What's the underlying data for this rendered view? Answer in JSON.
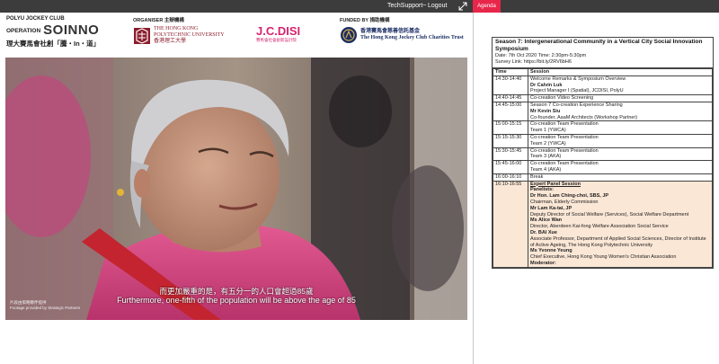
{
  "topbar": {
    "tech_support": "TechSupport~",
    "logout": "Logout",
    "agenda_tab": "Agenda"
  },
  "logos": {
    "polyu_club": "POLYU JOCKEY CLUB",
    "operation": "OPERATION",
    "soinno": "SOINNO",
    "zh_title": "理大賽馬會社創「騰・In・道」",
    "organiser_label": "ORGANISER 主辦機構",
    "polyu_line1": "THE HONG KONG",
    "polyu_line2": "POLYTECHNIC UNIVERSITY",
    "polyu_zh": "香港理工大學",
    "jcdisi": "J.C.DISI",
    "jcdisi_sub": "賽馬會社會創新設計院",
    "funded_label": "FUNDED BY 捐助機構",
    "hkjc_zh": "香港賽馬會慈善信託基金",
    "hkjc_en": "The Hong Kong Jockey Club Charities Trust"
  },
  "video": {
    "subtitle_zh": "而更加嚴重的是，有五分一的人口會超過85歲",
    "subtitle_en": "Furthermore, one-fifth of the population will be above the age of 85",
    "credit_zh": "片段由策略夥伴提供",
    "credit_en": "Footage provided by Strategic Partners"
  },
  "agenda": {
    "title": "Season 7: Intergenerational Community in a Vertical City Social Innovation Symposium",
    "date_line": "Date: 7th Oct 2020  Time: 2:30pm-5:30pm",
    "survey_line": "Survey Link: https://bit.ly/2RV6bH6",
    "col_time": "Time",
    "col_session": "Session",
    "rows": [
      {
        "time": "14:30-14:40",
        "title": "Welcome Remarks & Symposium Overview",
        "speaker": "Dr Calvin Luk",
        "role": "Project Manager I (Spatial), JCDISI, PolyU"
      },
      {
        "time": "14:40-14:45",
        "title": "Co-creation Video Screening",
        "speaker": "",
        "role": ""
      },
      {
        "time": "14:45-15:00",
        "title": "Season 7 Co-creation Experience Sharing",
        "speaker": "Mr Kevin Siu",
        "role": "Co-founder, AaaM Architects (Workshop Partner)"
      },
      {
        "time": "15:00-15:15",
        "title": "Co-creation Team Presentation",
        "speaker": "",
        "role": "Team 1 (YWCA)"
      },
      {
        "time": "15:15-15:30",
        "title": "Co-creation Team Presentation",
        "speaker": "",
        "role": "Team 2 (YWCA)"
      },
      {
        "time": "15:30-15:45",
        "title": "Co-creation Team Presentation",
        "speaker": "",
        "role": "Team 3 (AKA)"
      },
      {
        "time": "15:45-16:00",
        "title": "Co-creation Team Presentation",
        "speaker": "",
        "role": "Team 4 (AKA)"
      },
      {
        "time": "16:00-16:10",
        "title": "Break",
        "speaker": "",
        "role": ""
      }
    ],
    "panel": {
      "time": "16:10-16:55",
      "title": "Expert Panel Session",
      "panelists_label": "Panelists:",
      "panelists": [
        {
          "name": "Dr Hon. Lam Ching-choi, SBS, JP",
          "role": "Chairman, Elderly Commission"
        },
        {
          "name": "Mr Lam Ka-tai, JP",
          "role": "Deputy Director of Social Welfare (Services), Social Welfare Department"
        },
        {
          "name": "Ms Alice Wan",
          "role": "Director, Aberdeen Kai-fong Welfare Association Social Service"
        },
        {
          "name": "Dr. BAI Xue",
          "role": "Associate Professor, Department of Applied Social Sciences, Director of Institute of Active Ageing, The Hong Kong Polytechnic University"
        },
        {
          "name": "Ms Yvonne Yeung",
          "role": "Chief Executive, Hong Kong Young Women's Christian Association"
        }
      ],
      "moderator_label": "Moderator:"
    }
  }
}
